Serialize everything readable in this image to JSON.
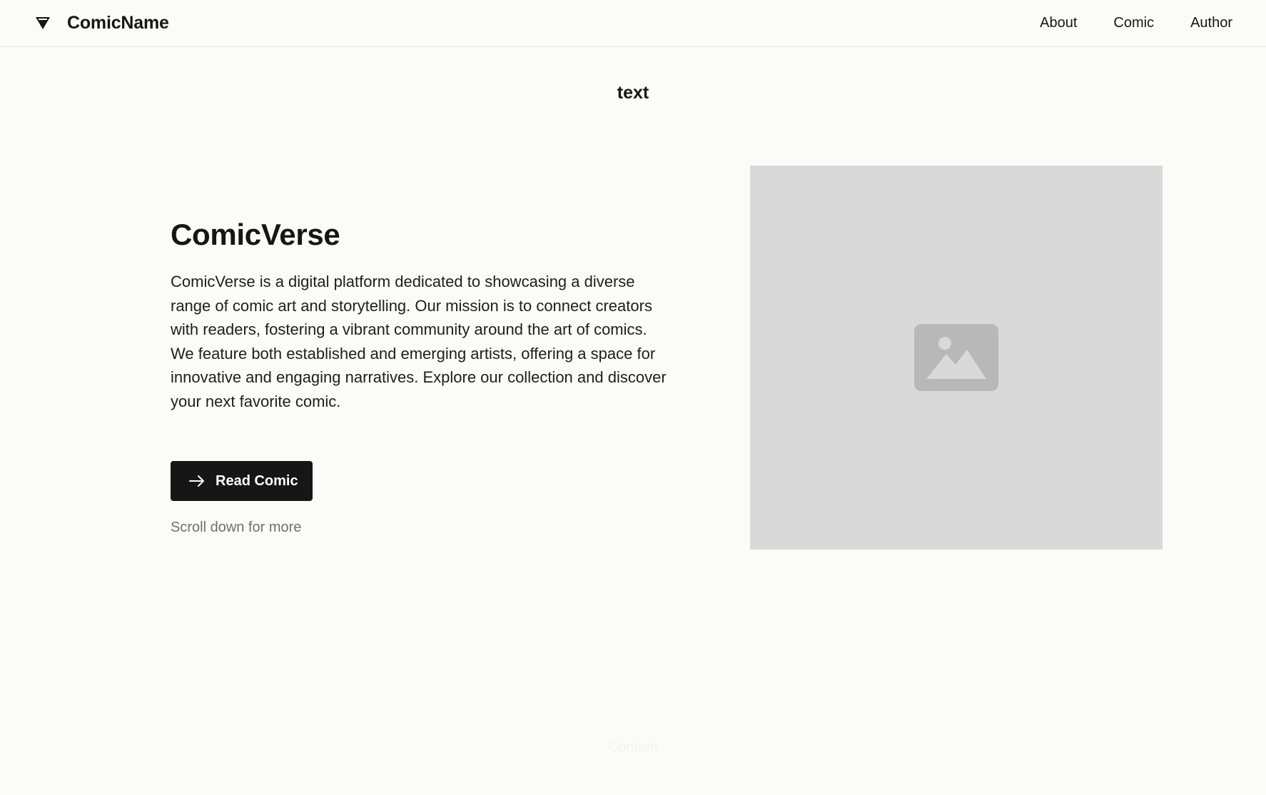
{
  "header": {
    "brand_name": "ComicName",
    "brand_icon": "triangle-logo-icon",
    "nav": [
      {
        "label": "About"
      },
      {
        "label": "Comic"
      },
      {
        "label": "Author"
      }
    ]
  },
  "section": {
    "heading": "text"
  },
  "hero": {
    "title": "ComicVerse",
    "description": "ComicVerse is a digital platform dedicated to showcasing a diverse range of comic art and storytelling. Our mission is to connect creators with readers, fostering a vibrant community around the art of comics. We feature both established and emerging artists, offering a space for innovative and engaging narratives. Explore our collection and discover your next favorite comic.",
    "cta_label": "Read Comic",
    "cta_icon": "arrow-right-icon",
    "scroll_hint": "Scroll down for more",
    "image_icon": "image-placeholder-icon"
  },
  "footer": {
    "faint_text": "Content"
  },
  "colors": {
    "background": "#fbfcf8",
    "text": "#161616",
    "button_bg": "#161616",
    "button_text": "#ffffff",
    "muted_text": "#6f6f6f",
    "image_placeholder": "#d9d9d9",
    "image_icon": "#b8b8b8"
  }
}
